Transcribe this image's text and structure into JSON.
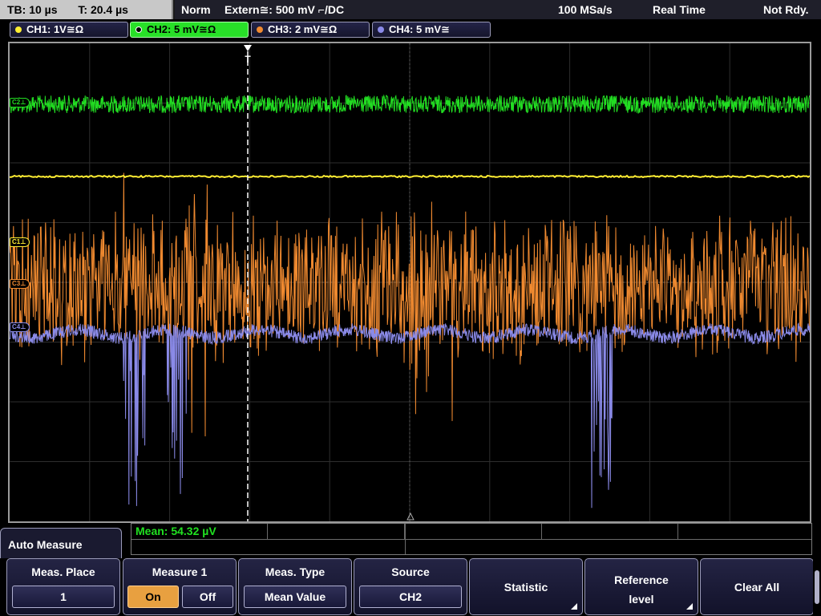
{
  "status": {
    "timebase": "TB: 10 µs",
    "trigger_time": "T: 20.4 µs",
    "mode": "Norm",
    "trigger_source": "Extern≅: 500 mV ⌐/DC",
    "sample_rate": "100 MSa/s",
    "acq_mode": "Real Time",
    "state": "Not Rdy."
  },
  "channels": [
    {
      "label": "CH1: 1V≅Ω",
      "color": "#ffee33"
    },
    {
      "label": "CH2: 5 mV≅Ω",
      "color": "#22dd22"
    },
    {
      "label": "CH3: 2 mV≅Ω",
      "color": "#f08a30"
    },
    {
      "label": "CH4: 5 mV≅",
      "color": "#8a8ae8"
    }
  ],
  "markers": {
    "c2": "C2⊥",
    "c1": "C1⊥",
    "c3": "C3⊥",
    "c4": "C4⊥",
    "trigger": "T"
  },
  "measurement": {
    "result": "Mean: 54.32 µV"
  },
  "menu": {
    "title": "Auto Measure",
    "softkeys": {
      "meas_place": {
        "title": "Meas. Place",
        "value": "1"
      },
      "measure": {
        "title": "Measure 1",
        "on": "On",
        "off": "Off",
        "state": "On"
      },
      "meas_type": {
        "title": "Meas. Type",
        "value": "Mean Value"
      },
      "source": {
        "title": "Source",
        "value": "CH2"
      },
      "statistic": {
        "title": "Statistic"
      },
      "reference_level": {
        "line1": "Reference",
        "line2": "level"
      },
      "clear_all": {
        "title": "Clear All"
      }
    }
  }
}
